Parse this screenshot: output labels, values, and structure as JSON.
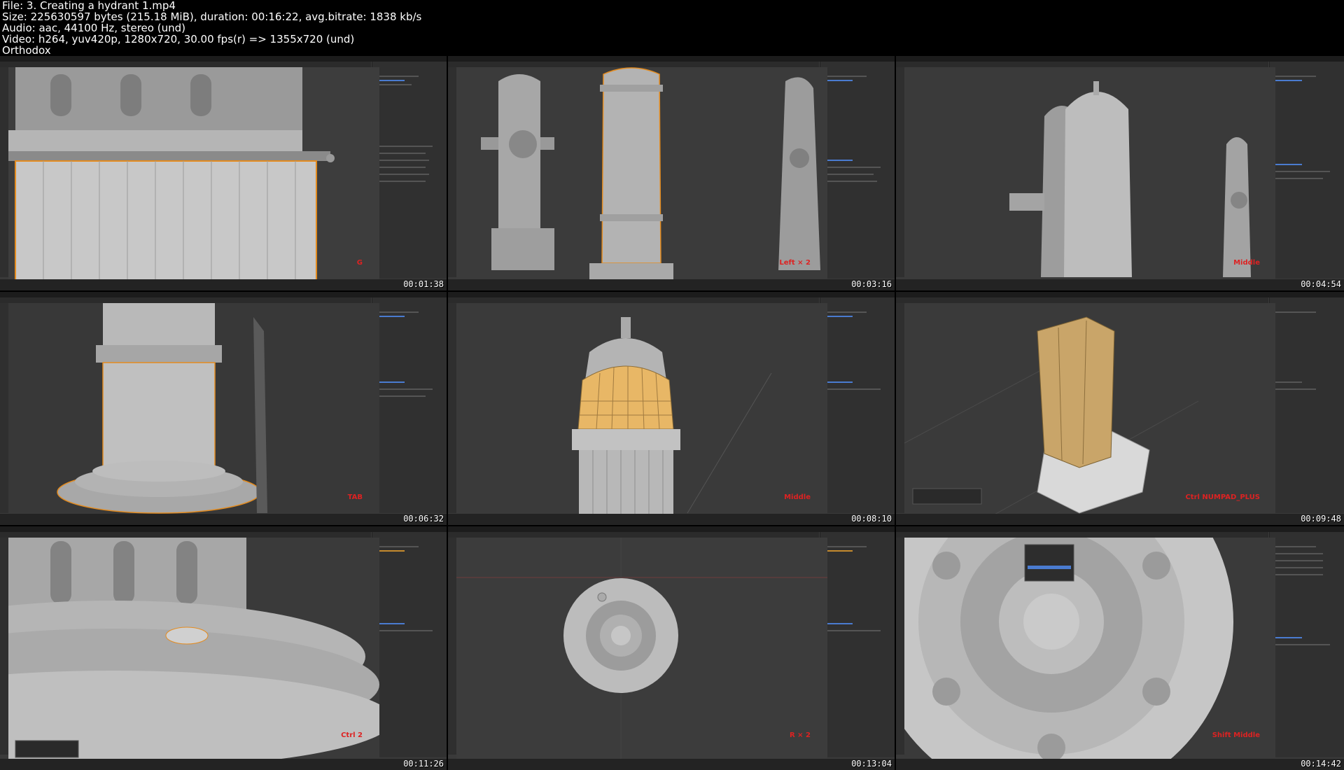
{
  "info": {
    "file": "File: 3. Creating a hydrant 1.mp4",
    "size": "Size: 225630597 bytes (215.18 MiB), duration: 00:16:22, avg.bitrate: 1838 kb/s",
    "audio": "Audio: aac, 44100 Hz, stereo (und)",
    "video": "Video: h264, yuv420p, 1280x720, 30.00 fps(r) => 1355x720 (und)",
    "author": "Orthodox"
  },
  "thumbnails": [
    {
      "timestamp": "00:01:38",
      "key": "G"
    },
    {
      "timestamp": "00:03:16",
      "key": "Left × 2"
    },
    {
      "timestamp": "00:04:54",
      "key": "Middle"
    },
    {
      "timestamp": "00:06:32",
      "key": "TAB"
    },
    {
      "timestamp": "00:08:10",
      "key": "Middle"
    },
    {
      "timestamp": "00:09:48",
      "key": "Ctrl NUMPAD_PLUS"
    },
    {
      "timestamp": "00:11:26",
      "key": "Ctrl 2"
    },
    {
      "timestamp": "00:13:04",
      "key": "R × 2"
    },
    {
      "timestamp": "00:14:42",
      "key": "Shift Middle"
    }
  ],
  "colors": {
    "viewport": "#3a3a3a",
    "panel": "#303030",
    "select": "#e38b1f",
    "face": "#e8b766"
  }
}
